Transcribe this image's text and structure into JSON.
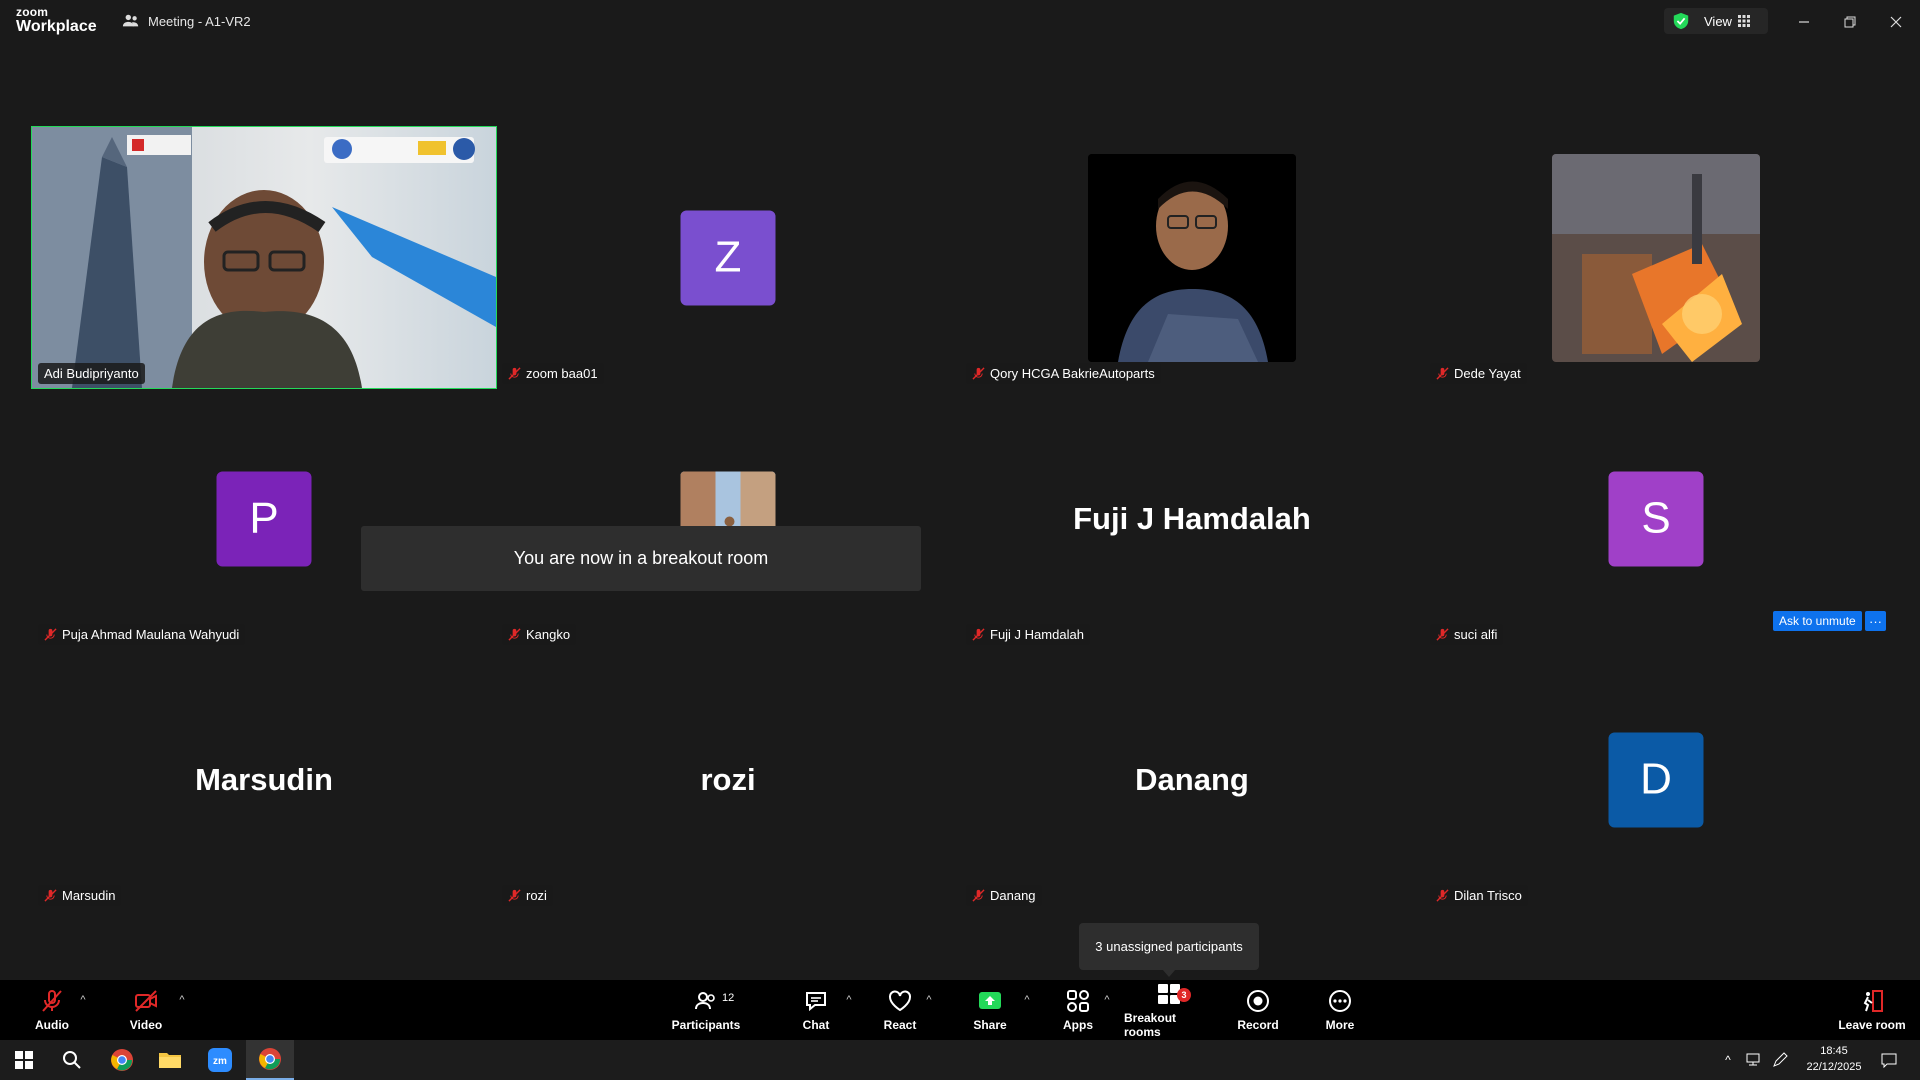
{
  "app": {
    "logo_top": "zoom",
    "logo_bottom": "Workplace",
    "meeting_title": "Meeting - A1-VR2",
    "view_label": "View"
  },
  "tiles": [
    {
      "name": "Adi Budipriyanto",
      "type": "video",
      "muted": false,
      "active": true
    },
    {
      "name": "zoom baa01",
      "type": "letter",
      "letter": "Z",
      "color": "#7a4fcf",
      "muted": true
    },
    {
      "name": "Qory HCGA BakrieAutoparts",
      "type": "photo",
      "muted": true
    },
    {
      "name": "Dede Yayat",
      "type": "photo",
      "muted": true
    },
    {
      "name": "Puja Ahmad Maulana Wahyudi",
      "type": "letter",
      "letter": "P",
      "color": "#7b23b8",
      "muted": true
    },
    {
      "name": "Kangko",
      "type": "photo",
      "muted": true
    },
    {
      "name": "Fuji J Hamdalah",
      "type": "text",
      "display": "Fuji J Hamdalah",
      "muted": true
    },
    {
      "name": "suci alfi",
      "type": "letter",
      "letter": "S",
      "color": "#a040c8",
      "muted": true
    },
    {
      "name": "Marsudin",
      "type": "text",
      "display": "Marsudin",
      "muted": true
    },
    {
      "name": "rozi",
      "type": "text",
      "display": "rozi",
      "muted": true
    },
    {
      "name": "Danang",
      "type": "text",
      "display": "Danang",
      "muted": true
    },
    {
      "name": "Dilan Trisco",
      "type": "letter",
      "letter": "D",
      "color": "#0b5aa6",
      "muted": true
    }
  ],
  "toast": "You are now in a breakout room",
  "ask_unmute": "Ask to unmute",
  "ask_more": "···",
  "tooltip": "3 unassigned participants",
  "toolbar": {
    "audio": "Audio",
    "video": "Video",
    "participants": "Participants",
    "participants_count": "12",
    "chat": "Chat",
    "react": "React",
    "share": "Share",
    "apps": "Apps",
    "breakout": "Breakout rooms",
    "breakout_badge": "3",
    "record": "Record",
    "more": "More",
    "leave": "Leave room"
  },
  "taskbar": {
    "time": "18:45",
    "date": "22/12/2025"
  },
  "colors": {
    "accent": "#0e72ed",
    "active_speaker": "#23d959",
    "share_green": "#23d959",
    "mute_red": "#e02828"
  }
}
